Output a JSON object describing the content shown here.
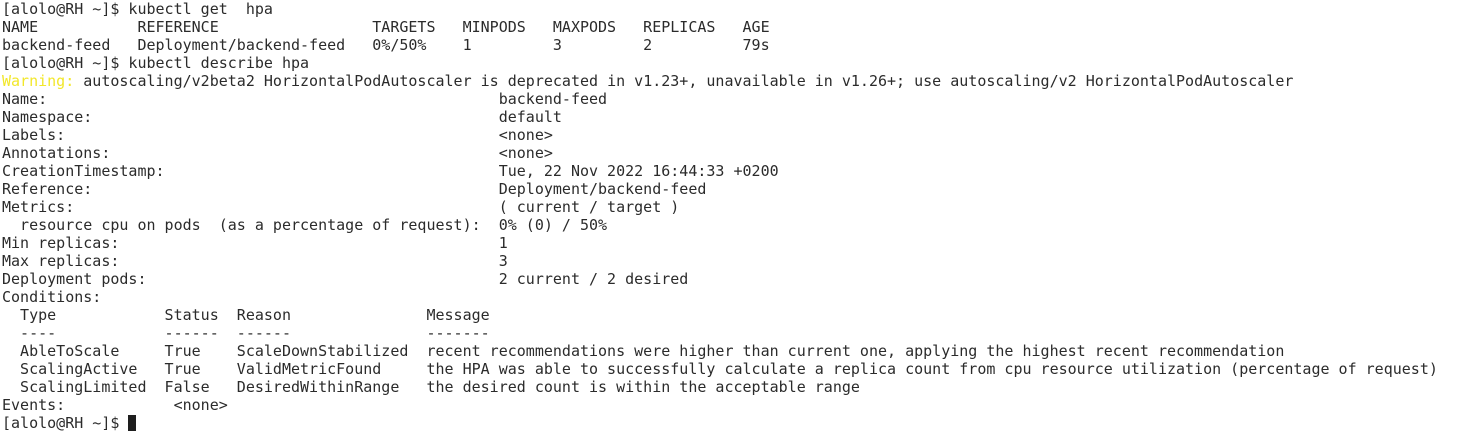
{
  "terminal": {
    "lines": [
      "[alolo@RH ~]$ kubectl get  hpa",
      "NAME           REFERENCE                 TARGETS   MINPODS   MAXPODS   REPLICAS   AGE",
      "backend-feed   Deployment/backend-feed   0%/50%    1         3         2          79s",
      "[alolo@RH ~]$ kubectl describe hpa"
    ],
    "warning_label": "Warning:",
    "warning_text": " autoscaling/v2beta2 HorizontalPodAutoscaler is deprecated in v1.23+, unavailable in v1.26+; use autoscaling/v2 HorizontalPodAutoscaler",
    "describe_lines": [
      "Name:                                                  backend-feed",
      "Namespace:                                             default",
      "Labels:                                                <none>",
      "Annotations:                                           <none>",
      "CreationTimestamp:                                     Tue, 22 Nov 2022 16:44:33 +0200",
      "Reference:                                             Deployment/backend-feed",
      "Metrics:                                               ( current / target )",
      "  resource cpu on pods  (as a percentage of request):  0% (0) / 50%",
      "Min replicas:                                          1",
      "Max replicas:                                          3",
      "Deployment pods:                                       2 current / 2 desired",
      "Conditions:",
      "  Type            Status  Reason               Message",
      "  ----            ------  ------               -------",
      "  AbleToScale     True    ScaleDownStabilized  recent recommendations were higher than current one, applying the highest recent recommendation",
      "  ScalingActive   True    ValidMetricFound     the HPA was able to successfully calculate a replica count from cpu resource utilization (percentage of request)",
      "  ScalingLimited  False   DesiredWithinRange   the desired count is within the acceptable range",
      "Events:            <none>"
    ],
    "prompt": "[alolo@RH ~]$ "
  },
  "colors": {
    "background": "#ffffff",
    "text": "#2b2b2b",
    "warning": "#f2e72a",
    "cursor": "#1e1e1e"
  }
}
